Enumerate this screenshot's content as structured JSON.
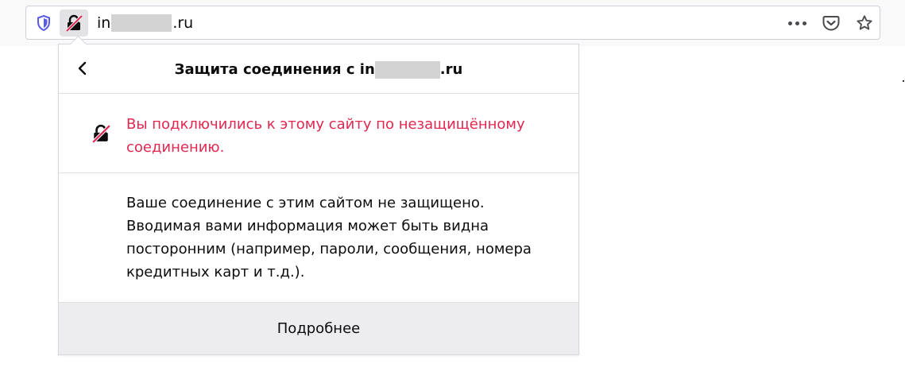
{
  "urlbar": {
    "url_prefix": "in",
    "url_suffix": ".ru",
    "icons": {
      "tracking": "tracking-protection-shield-icon",
      "lock": "insecure-lock-icon",
      "more": "more-actions-icon",
      "pocket": "pocket-icon",
      "bookmark": "bookmark-star-icon"
    }
  },
  "panel": {
    "title_prefix": "Защита соединения с in",
    "title_suffix": ".ru",
    "warning": "Вы подключились к этому сайту по незащищённому соединению.",
    "description": "Ваше соединение с этим сайтом не защищено. Вводимая вами информация может быть видна посторонним (например, пароли, сообщения, номера кредитных карт и т.д.).",
    "more_button": "Подробнее"
  },
  "colors": {
    "warning_text": "#e22850",
    "shield": "#5b5bea",
    "footer_bg": "#ededf0"
  }
}
